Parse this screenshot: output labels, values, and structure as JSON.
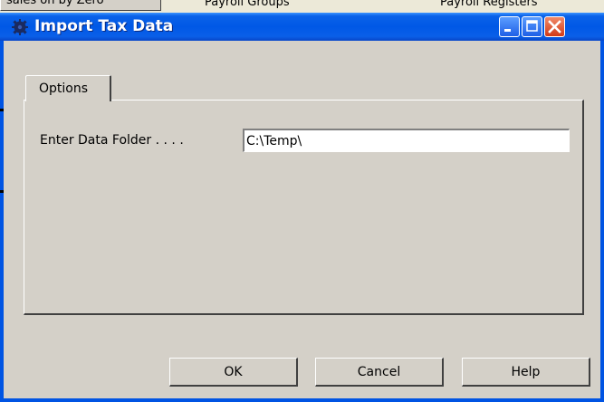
{
  "background_app": {
    "button_label": "sales on by Zero",
    "column_1": "Payroll Groups",
    "column_2": "Payroll Registers"
  },
  "window": {
    "title": "Import Tax Data",
    "title_icon": "gear-icon"
  },
  "tabs": [
    {
      "label": "Options"
    }
  ],
  "form": {
    "data_folder_label": "Enter Data Folder . . . .",
    "data_folder_value": "C:\\Temp\\"
  },
  "buttons": {
    "ok_label": "OK",
    "cancel_label": "Cancel",
    "help_label": "Help"
  },
  "colors": {
    "titlebar": "#0058e6",
    "close_button": "#d23a17",
    "dialog_face": "#d4d0c8"
  }
}
